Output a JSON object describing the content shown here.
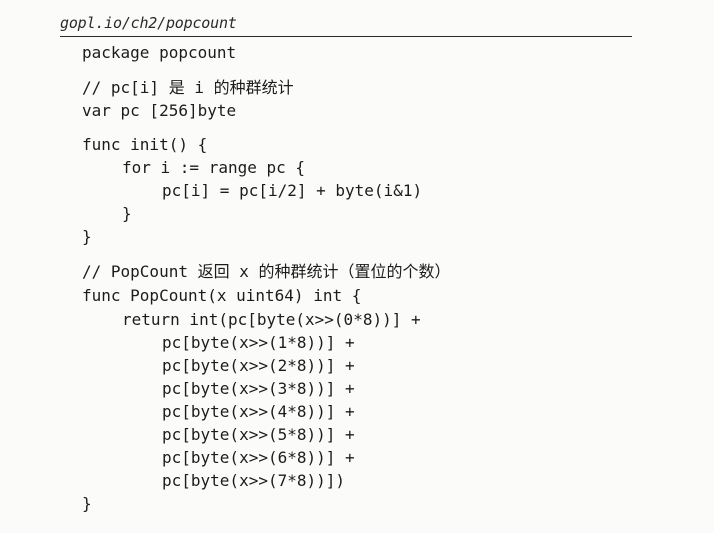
{
  "header": {
    "source_path": "gopl.io/ch2/popcount"
  },
  "code": {
    "lines": [
      "package popcount",
      "// pc[i] 是 i 的种群统计",
      "var pc [256]byte",
      "func init() {",
      "for i := range pc {",
      "pc[i] = pc[i/2] + byte(i&1)",
      "}",
      "}",
      "// PopCount 返回 x 的种群统计（置位的个数）",
      "func PopCount(x uint64) int {",
      "return int(pc[byte(x>>(0*8))] +",
      "pc[byte(x>>(1*8))] +",
      "pc[byte(x>>(2*8))] +",
      "pc[byte(x>>(3*8))] +",
      "pc[byte(x>>(4*8))] +",
      "pc[byte(x>>(5*8))] +",
      "pc[byte(x>>(6*8))] +",
      "pc[byte(x>>(7*8))])",
      "}"
    ]
  }
}
